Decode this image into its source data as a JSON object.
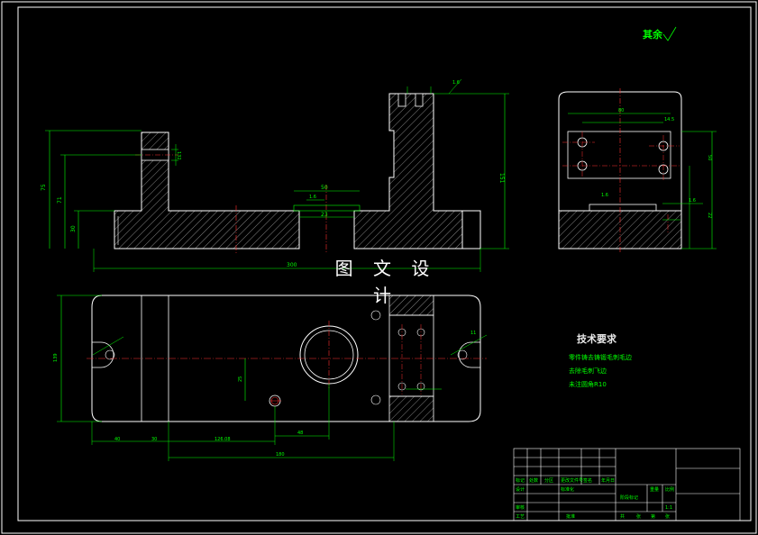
{
  "watermark": "图 文 设 计",
  "surface_note": "其余",
  "tech_requirements": {
    "title": "技术要求",
    "items": [
      "零件铸去铸锻毛刺毛边",
      "去除毛刺飞边",
      "未注圆角R10"
    ]
  },
  "dimensions": {
    "total_width": "300",
    "bottom_span": "180",
    "plan_width": "126.08",
    "left_offset": "40",
    "hole_offset": "48",
    "hole_pos": "25",
    "gap_width": "23",
    "gap_width_2": "50",
    "height_total": "151",
    "height_left": "75",
    "height_mid": "71",
    "height_base": "30",
    "slot_label": "132",
    "side_width": "80",
    "side_half": "14.5",
    "side_height": "50",
    "side_depth": "22",
    "tolerance_1": "1.6",
    "tolerance_2": "1.6",
    "tolerance_3": "1.6",
    "plan_depth": "139",
    "notch": "11"
  },
  "title_block": {
    "labels": [
      "标记",
      "处数",
      "分区",
      "更改文件号",
      "签名",
      "年月日",
      "设计",
      "标准化",
      "审核",
      "工艺",
      "批准",
      "阶段标记",
      "重量",
      "比例",
      "共",
      "张",
      "第"
    ],
    "scale": "1:1"
  }
}
